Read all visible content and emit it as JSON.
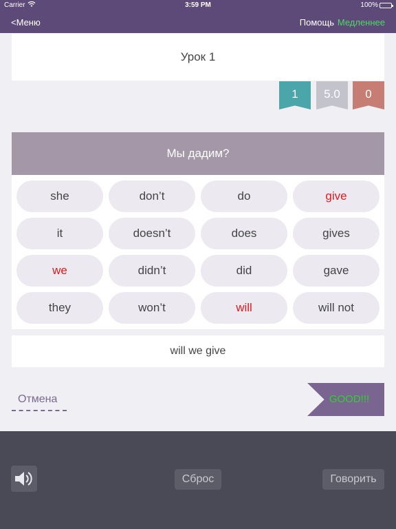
{
  "statusbar": {
    "carrier": "Carrier",
    "time": "3:59 PM",
    "battery": "100%"
  },
  "navbar": {
    "back_label": "<Меню",
    "help_label": "Помощь",
    "slower_label": "Медленнее"
  },
  "lesson": {
    "title": "Урок 1"
  },
  "badges": {
    "count": "1",
    "score": "5.0",
    "errors": "0"
  },
  "question": {
    "text": "Мы дадим?"
  },
  "words": [
    [
      {
        "text": "she",
        "highlight": false
      },
      {
        "text": "don’t",
        "highlight": false
      },
      {
        "text": "do",
        "highlight": false
      },
      {
        "text": "give",
        "highlight": true
      }
    ],
    [
      {
        "text": "it",
        "highlight": false
      },
      {
        "text": "doesn’t",
        "highlight": false
      },
      {
        "text": "does",
        "highlight": false
      },
      {
        "text": "gives",
        "highlight": false
      }
    ],
    [
      {
        "text": "we",
        "highlight": true
      },
      {
        "text": "didn’t",
        "highlight": false
      },
      {
        "text": "did",
        "highlight": false
      },
      {
        "text": "gave",
        "highlight": false
      }
    ],
    [
      {
        "text": "they",
        "highlight": false
      },
      {
        "text": "won’t",
        "highlight": false
      },
      {
        "text": "will",
        "highlight": true
      },
      {
        "text": "will not",
        "highlight": false
      }
    ]
  ],
  "answer": {
    "text": "will we give"
  },
  "actions": {
    "cancel_label": "Отмена",
    "feedback_label": "GOOD!!!"
  },
  "bottom": {
    "speaker_icon": "speaker-icon",
    "reset_label": "Сброс",
    "speak_label": "Говорить"
  },
  "colors": {
    "header": "#5e4a78",
    "question_bg": "#a497a8",
    "highlight": "#e0191f",
    "feedback_text": "#2cd42c",
    "toolbar": "#4a4a56"
  }
}
